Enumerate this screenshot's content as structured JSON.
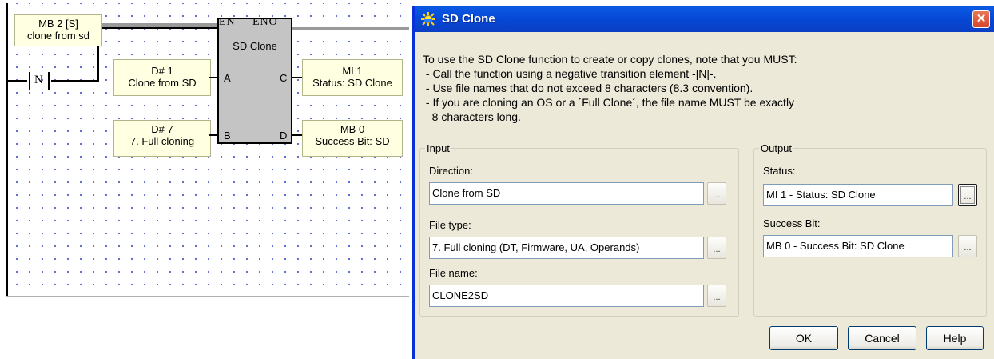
{
  "ladder": {
    "contact_label": "N",
    "comment": {
      "line1": "MB 2 [S]",
      "line2": "clone from sd"
    },
    "input_a": {
      "line1": "D# 1",
      "line2": "Clone from SD"
    },
    "input_b": {
      "line1": "D# 7",
      "line2": "7. Full cloning"
    },
    "output_c": {
      "line1": "MI 1",
      "line2": "Status: SD Clone"
    },
    "output_d": {
      "line1": "MB 0",
      "line2": "Success Bit: SD"
    },
    "block": {
      "en": "EN",
      "eno": "ENO",
      "title": "SD Clone",
      "pin_a": "A",
      "pin_b": "B",
      "pin_c": "C",
      "pin_d": "D"
    }
  },
  "dialog": {
    "title": "SD Clone",
    "close_glyph": "✕",
    "instructions": [
      "To use the SD Clone function to create or copy clones, note that you MUST:",
      " - Call the function using a negative transition element -|N|-.",
      " - Use file names that do not exceed 8 characters (8.3 convention).",
      " - If you are cloning an OS or a ´Full Clone´, the file name MUST be exactly",
      "   8 characters long."
    ],
    "input_group": {
      "legend": "Input",
      "direction_label": "Direction:",
      "direction_value": "Clone from SD",
      "filetype_label": "File type:",
      "filetype_value": "7. Full cloning (DT, Firmware, UA, Operands)",
      "filename_label": "File name:",
      "filename_value": "CLONE2SD"
    },
    "output_group": {
      "legend": "Output",
      "status_label": "Status:",
      "status_value": "MI 1  - Status: SD Clone",
      "success_label": "Success Bit:",
      "success_value": "MB 0  - Success Bit: SD Clone"
    },
    "browse_glyph": "...",
    "buttons": {
      "ok": "OK",
      "cancel": "Cancel",
      "help": "Help"
    }
  },
  "colors": {
    "titlebar": "#0a5ae4",
    "dialog_bg": "#ece9d8",
    "note_bg": "#ffffe1",
    "block_bg": "#c4c4c4",
    "grid_dot": "#5a6acf"
  }
}
